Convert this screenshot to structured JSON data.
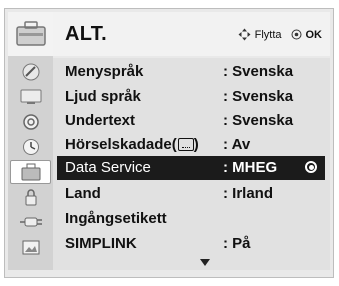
{
  "menu": {
    "title": "ALT.",
    "hint": {
      "move_label": "Flytta",
      "ok_label": "OK"
    },
    "rows": [
      {
        "label": "Menyspråk",
        "value": ": Svenska"
      },
      {
        "label": "Ljud språk",
        "value": ": Svenska"
      },
      {
        "label": "Undertext",
        "value": ": Svenska"
      },
      {
        "label": "Hörselskadade(",
        "label_suffix": ")",
        "value": ": Av"
      },
      {
        "label": "Data Service",
        "value": ": MHEG"
      },
      {
        "label": "Land",
        "value": ": Irland"
      },
      {
        "label": "Ingångsetikett",
        "value": ""
      },
      {
        "label": "SIMPLINK",
        "value": ": På"
      }
    ]
  },
  "sidebar": {
    "items": [
      {
        "icon": "satellite-dish-icon"
      },
      {
        "icon": "tv-screen-icon"
      },
      {
        "icon": "speaker-icon"
      },
      {
        "icon": "clock-icon"
      },
      {
        "icon": "toolbox-option-icon"
      },
      {
        "icon": "lock-icon"
      },
      {
        "icon": "input-plug-icon"
      },
      {
        "icon": "usb-photo-icon"
      }
    ]
  }
}
